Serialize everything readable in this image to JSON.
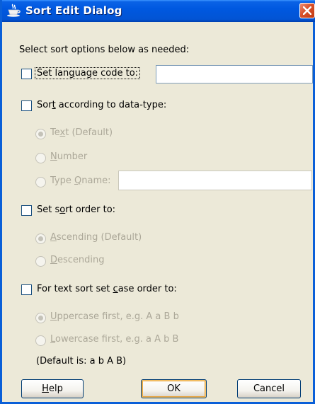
{
  "window": {
    "title": "Sort Edit Dialog",
    "icon": "coffee-cup-icon",
    "accent_color": "#0058e0",
    "close_color": "#d9512b"
  },
  "intro_text": "Select sort options below as needed:",
  "language_code": {
    "label_pre": "Set lan",
    "label_u": "g",
    "label_post": "uage code to:",
    "checked": false,
    "value": ""
  },
  "data_type": {
    "label_pre": "Sor",
    "label_u": "t",
    "label_post": " according to data-type:",
    "checked": false,
    "options": [
      {
        "pre": "Te",
        "u": "x",
        "post": "t  (Default)",
        "selected": true
      },
      {
        "pre": "",
        "u": "N",
        "post": "umber",
        "selected": false
      },
      {
        "pre": "Type ",
        "u": "Q",
        "post": "name:",
        "selected": false
      }
    ],
    "qname_value": ""
  },
  "sort_order": {
    "label_pre": "Set s",
    "label_u": "o",
    "label_post": "rt order to:",
    "checked": false,
    "options": [
      {
        "pre": "",
        "u": "A",
        "post": "scending  (Default)",
        "selected": true
      },
      {
        "pre": "",
        "u": "D",
        "post": "escending",
        "selected": false
      }
    ]
  },
  "case_order": {
    "label_pre": "For text sort set ",
    "label_u": "c",
    "label_post": "ase order to:",
    "checked": false,
    "options": [
      {
        "pre": "",
        "u": "U",
        "post": "ppercase first, e.g. A a B b",
        "selected": true
      },
      {
        "pre": "",
        "u": "L",
        "post": "owercase first, e.g. a A b B",
        "selected": false
      }
    ],
    "default_note": "(Default is: a b A B)"
  },
  "buttons": {
    "help_pre": "",
    "help_u": "H",
    "help_post": "elp",
    "ok": "OK",
    "cancel": "Cancel"
  }
}
